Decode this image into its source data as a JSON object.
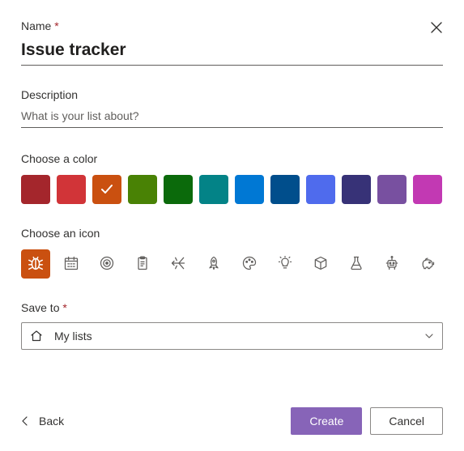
{
  "labels": {
    "name": "Name",
    "description": "Description",
    "choose_color": "Choose a color",
    "choose_icon": "Choose an icon",
    "save_to": "Save to"
  },
  "name_value": "Issue tracker",
  "description_value": "",
  "description_placeholder": "What is your list about?",
  "colors": [
    {
      "name": "Dark red",
      "hex": "#a4262c",
      "selected": false
    },
    {
      "name": "Red",
      "hex": "#d13438",
      "selected": false
    },
    {
      "name": "Orange",
      "hex": "#ca5010",
      "selected": true
    },
    {
      "name": "Green",
      "hex": "#498205",
      "selected": false
    },
    {
      "name": "Dark green",
      "hex": "#0b6a0b",
      "selected": false
    },
    {
      "name": "Teal",
      "hex": "#038387",
      "selected": false
    },
    {
      "name": "Blue",
      "hex": "#0078d4",
      "selected": false
    },
    {
      "name": "Dark blue",
      "hex": "#004e8c",
      "selected": false
    },
    {
      "name": "Indigo",
      "hex": "#4f6bed",
      "selected": false
    },
    {
      "name": "Navy",
      "hex": "#373277",
      "selected": false
    },
    {
      "name": "Purple",
      "hex": "#7850a0",
      "selected": false
    },
    {
      "name": "Pink",
      "hex": "#c239b3",
      "selected": false
    }
  ],
  "icons": [
    {
      "name": "bug",
      "selected": true
    },
    {
      "name": "calendar",
      "selected": false
    },
    {
      "name": "target",
      "selected": false
    },
    {
      "name": "clipboard",
      "selected": false
    },
    {
      "name": "airplane",
      "selected": false
    },
    {
      "name": "rocket",
      "selected": false
    },
    {
      "name": "palette",
      "selected": false
    },
    {
      "name": "lightbulb",
      "selected": false
    },
    {
      "name": "cube",
      "selected": false
    },
    {
      "name": "beaker",
      "selected": false
    },
    {
      "name": "robot",
      "selected": false
    },
    {
      "name": "piggybank",
      "selected": false
    }
  ],
  "save_to": {
    "selected": "My lists"
  },
  "buttons": {
    "back": "Back",
    "create": "Create",
    "cancel": "Cancel"
  }
}
